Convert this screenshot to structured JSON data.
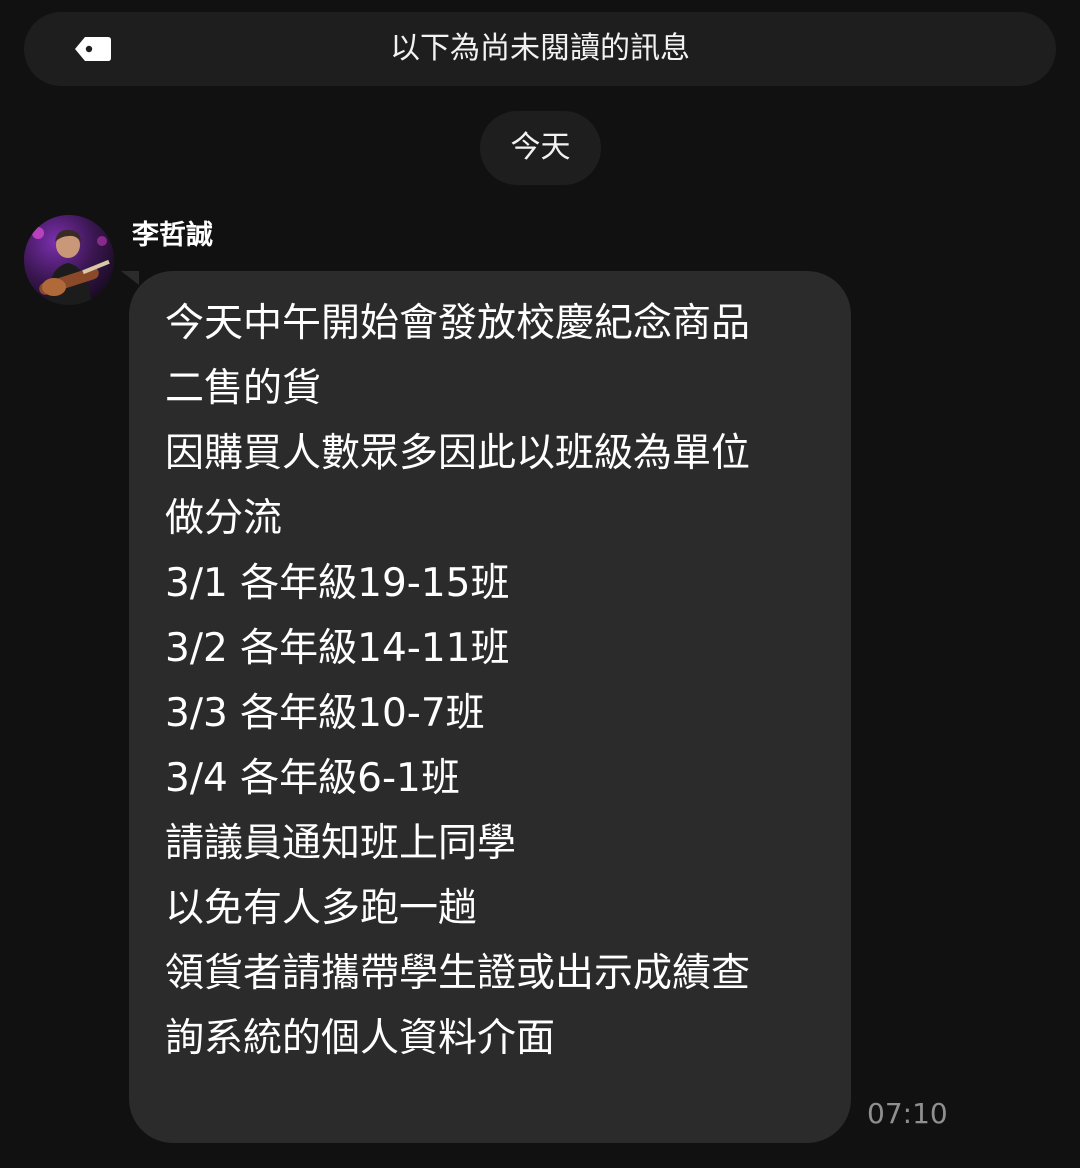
{
  "unread_banner": {
    "icon": "tag-icon",
    "text": "以下為尚未閱讀的訊息"
  },
  "date_separator": "今天",
  "message": {
    "sender": "李哲誠",
    "avatar": "avatar-photo",
    "lines": [
      "今天中午開始會發放校慶紀念商品",
      "二售的貨",
      "因購買人數眾多因此以班級為單位",
      "做分流",
      "3/1 各年級19-15班",
      "3/2 各年級14-11班",
      "3/3 各年級10-7班",
      "3/4 各年級6-1班",
      "請議員通知班上同學",
      "以免有人多跑一趟",
      "領貨者請攜帶學生證或出示成績查",
      "詢系統的個人資料介面"
    ],
    "time": "07:10"
  },
  "colors": {
    "background": "#111111",
    "banner": "#1e1e1e",
    "bubble": "#2b2b2b",
    "timestamp": "#8f8f8f"
  }
}
